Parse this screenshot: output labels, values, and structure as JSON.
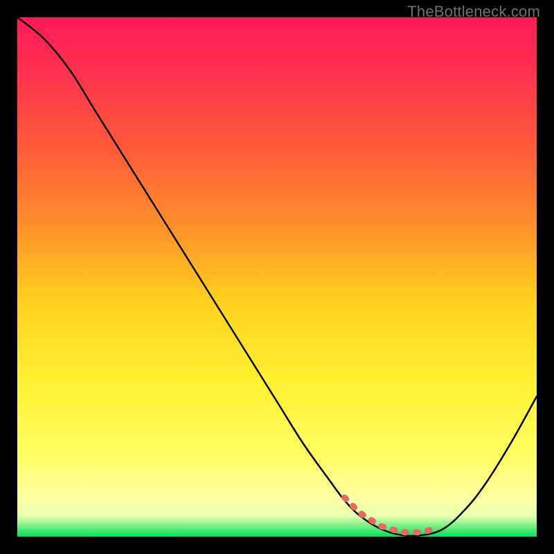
{
  "watermark": "TheBottleneck.com",
  "chart_data": {
    "type": "line",
    "title": "",
    "xlabel": "",
    "ylabel": "",
    "x_range": [
      0,
      100
    ],
    "y_range": [
      0,
      100
    ],
    "series": [
      {
        "name": "bottleneck-curve",
        "x": [
          0,
          5,
          10,
          15,
          20,
          25,
          30,
          35,
          40,
          45,
          50,
          55,
          60,
          63,
          66,
          70,
          74,
          78,
          82,
          86,
          90,
          95,
          100
        ],
        "y": [
          100,
          96,
          90,
          82,
          74,
          66,
          58,
          50,
          42,
          34,
          26,
          18,
          11,
          7,
          4,
          1.5,
          0.3,
          0.3,
          1.5,
          5,
          10,
          18,
          27
        ]
      }
    ],
    "optimal_region_x": [
      63,
      80
    ],
    "gradient_stops": [
      {
        "offset": 0.0,
        "color": "#ff1a58"
      },
      {
        "offset": 0.1,
        "color": "#ff3050"
      },
      {
        "offset": 0.25,
        "color": "#ff5a3a"
      },
      {
        "offset": 0.4,
        "color": "#ff8f2a"
      },
      {
        "offset": 0.55,
        "color": "#ffd21f"
      },
      {
        "offset": 0.7,
        "color": "#fff030"
      },
      {
        "offset": 0.85,
        "color": "#ffff66"
      },
      {
        "offset": 0.92,
        "color": "#ffffa0"
      },
      {
        "offset": 0.96,
        "color": "#e8ffb0"
      },
      {
        "offset": 1.0,
        "color": "#00e05a"
      }
    ],
    "dash_color": "#e26b63",
    "curve_color": "#000000"
  }
}
